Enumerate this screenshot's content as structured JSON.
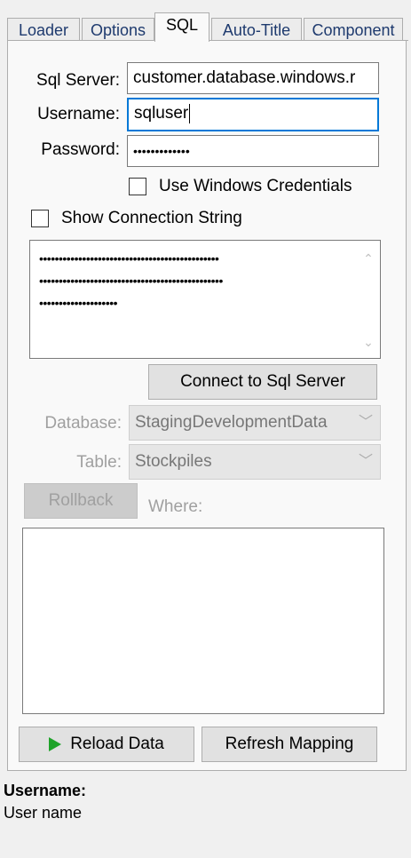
{
  "tabs": [
    {
      "label": "Loader"
    },
    {
      "label": "Options"
    },
    {
      "label": "SQL",
      "active": true
    },
    {
      "label": "Auto-Title"
    },
    {
      "label": "Component"
    }
  ],
  "sql": {
    "server_label": "Sql Server:",
    "server_value": "customer.database.windows.r",
    "username_label": "Username:",
    "username_value": "sqluser",
    "password_label": "Password:",
    "password_value": "•••••••••••••",
    "use_windows_credentials_label": "Use Windows Credentials",
    "use_windows_credentials_checked": false,
    "show_connection_string_label": "Show Connection String",
    "show_connection_string_checked": false,
    "connection_string_lines": [
      "••••••••••••••••••••••••••••••••••••••••••••••",
      "•••••••••••••••••••••••••••••••••••••••••••••••",
      "••••••••••••••••••••"
    ],
    "connect_button": "Connect to Sql Server",
    "database_label": "Database:",
    "database_value": "StagingDevelopmentData",
    "table_label": "Table:",
    "table_value": "Stockpiles",
    "rollback_button": "Rollback",
    "where_label": "Where:",
    "where_value": "",
    "reload_button": "Reload Data",
    "refresh_button": "Refresh Mapping"
  },
  "help": {
    "title": "Username:",
    "text": "User name"
  },
  "colors": {
    "focus_border": "#0078d7",
    "play_icon": "#1fa32a",
    "disabled_text": "#a0a0a0"
  }
}
